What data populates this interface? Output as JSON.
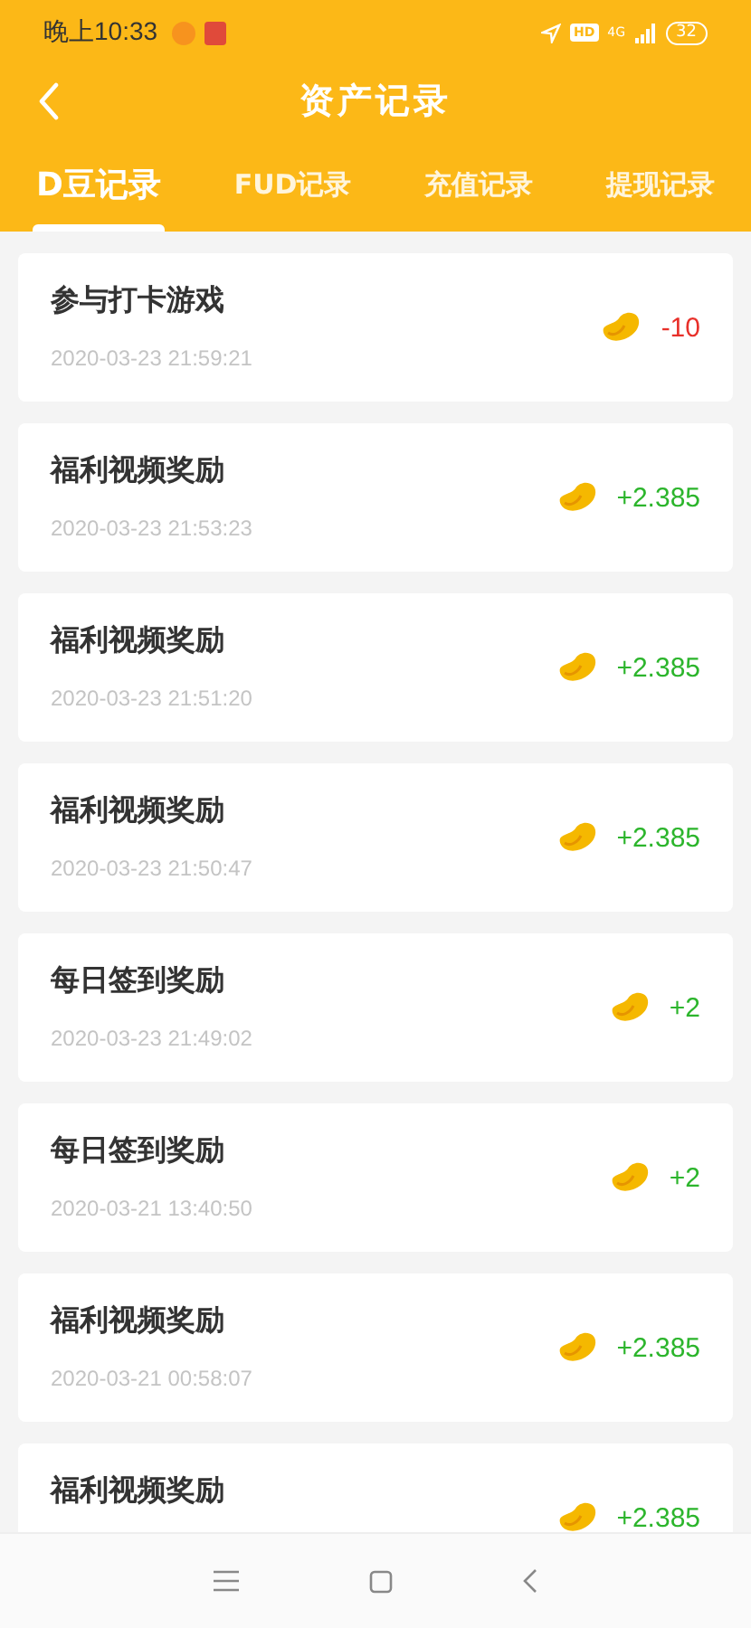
{
  "status_bar": {
    "time": "晚上10:33",
    "hd": "HD",
    "network": "4G",
    "battery": "32"
  },
  "header": {
    "title": "资产记录"
  },
  "tabs": [
    {
      "label": "D豆记录",
      "selected": true
    },
    {
      "label": "FUD记录",
      "selected": false
    },
    {
      "label": "充值记录",
      "selected": false
    },
    {
      "label": "提现记录",
      "selected": false
    }
  ],
  "records": [
    {
      "title": "参与打卡游戏",
      "time": "2020-03-23 21:59:21",
      "amount": "-10",
      "kind": "debit"
    },
    {
      "title": "福利视频奖励",
      "time": "2020-03-23 21:53:23",
      "amount": "+2.385",
      "kind": "credit"
    },
    {
      "title": "福利视频奖励",
      "time": "2020-03-23 21:51:20",
      "amount": "+2.385",
      "kind": "credit"
    },
    {
      "title": "福利视频奖励",
      "time": "2020-03-23 21:50:47",
      "amount": "+2.385",
      "kind": "credit"
    },
    {
      "title": "每日签到奖励",
      "time": "2020-03-23 21:49:02",
      "amount": "+2",
      "kind": "credit"
    },
    {
      "title": "每日签到奖励",
      "time": "2020-03-21 13:40:50",
      "amount": "+2",
      "kind": "credit"
    },
    {
      "title": "福利视频奖励",
      "time": "2020-03-21 00:58:07",
      "amount": "+2.385",
      "kind": "credit"
    },
    {
      "title": "福利视频奖励",
      "amount": "+2.385",
      "kind": "credit"
    }
  ]
}
